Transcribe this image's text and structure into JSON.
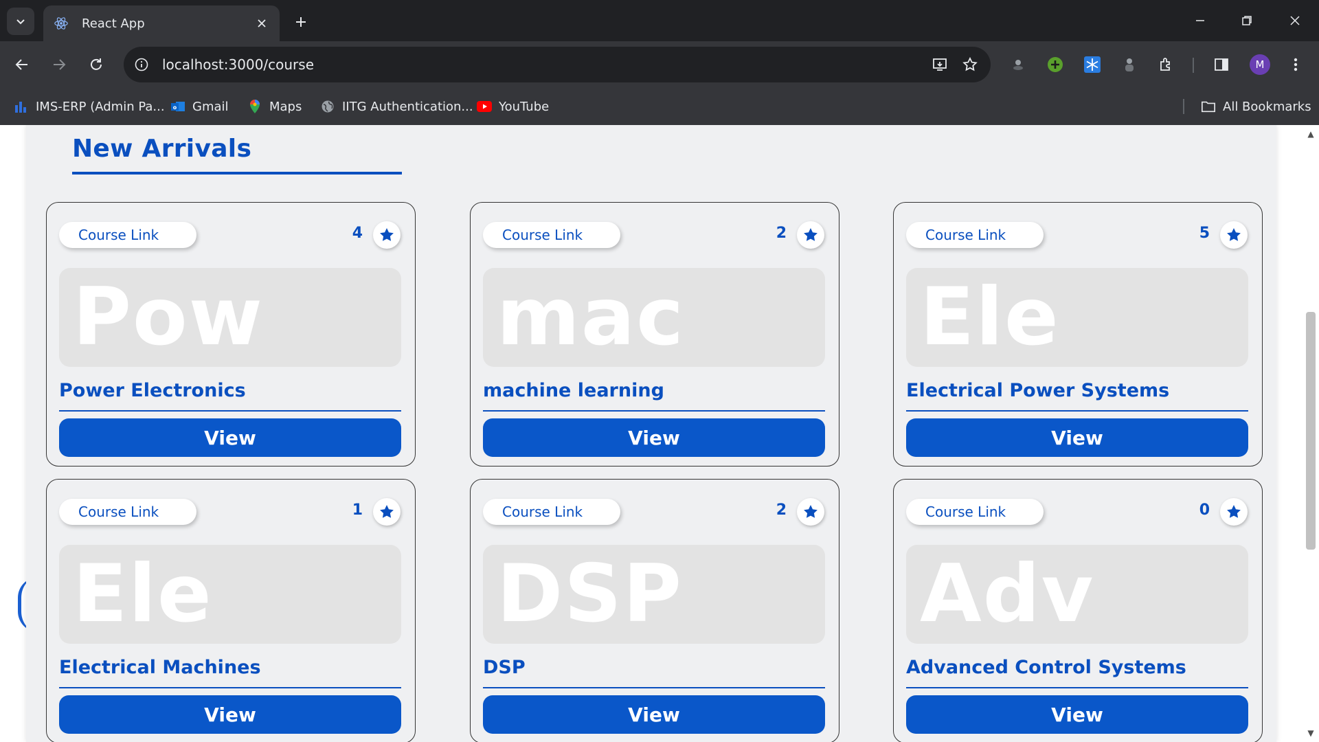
{
  "browser": {
    "tab_title": "React App",
    "url": "localhost:3000/course",
    "profile_initial": "M"
  },
  "bookmarks": [
    {
      "label": "IMS-ERP (Admin Pa...",
      "icon": "bar-chart-icon"
    },
    {
      "label": "Gmail",
      "icon": "outlook-icon"
    },
    {
      "label": "Maps",
      "icon": "maps-pin-icon"
    },
    {
      "label": "IITG Authentication...",
      "icon": "globe-icon"
    },
    {
      "label": "YouTube",
      "icon": "youtube-icon"
    }
  ],
  "all_bookmarks_label": "All Bookmarks",
  "section": {
    "title": "New Arrivals"
  },
  "colors": {
    "accent": "#0a4fbf",
    "button": "#0a57c9",
    "page_bg": "#eff0f2"
  },
  "courses": [
    {
      "link_label": "Course Link",
      "rating": "4",
      "thumb": "Pow",
      "name": "Power Electronics",
      "button": "View"
    },
    {
      "link_label": "Course Link",
      "rating": "2",
      "thumb": "mac",
      "name": "machine learning",
      "button": "View"
    },
    {
      "link_label": "Course Link",
      "rating": "5",
      "thumb": "Ele",
      "name": "Electrical Power Systems",
      "button": "View"
    },
    {
      "link_label": "Course Link",
      "rating": "1",
      "thumb": "Ele",
      "name": "Electrical Machines",
      "button": "View"
    },
    {
      "link_label": "Course Link",
      "rating": "2",
      "thumb": "DSP",
      "name": "DSP",
      "button": "View"
    },
    {
      "link_label": "Course Link",
      "rating": "0",
      "thumb": "Adv",
      "name": "Advanced Control Systems",
      "button": "View"
    }
  ]
}
